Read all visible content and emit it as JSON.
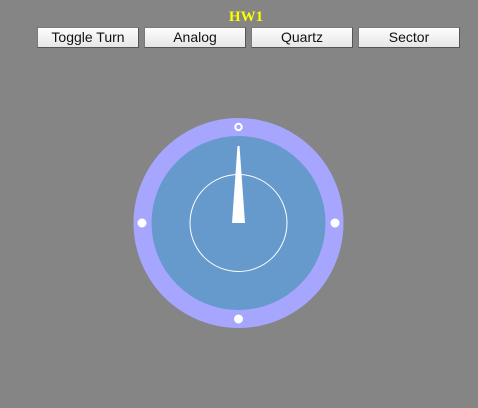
{
  "window": {
    "title": "HW1"
  },
  "toolbar": {
    "buttons": [
      {
        "id": "toggle-turn",
        "label": "Toggle Turn"
      },
      {
        "id": "analog",
        "label": "Analog"
      },
      {
        "id": "quartz",
        "label": "Quartz"
      },
      {
        "id": "sector",
        "label": "Sector"
      }
    ]
  },
  "colors": {
    "background": "#858585",
    "title": "#ffff00",
    "bezel": "#a6a6ff",
    "dial_face": "#6699cc",
    "markers": "#ffffff",
    "hand": "#ffffff"
  }
}
